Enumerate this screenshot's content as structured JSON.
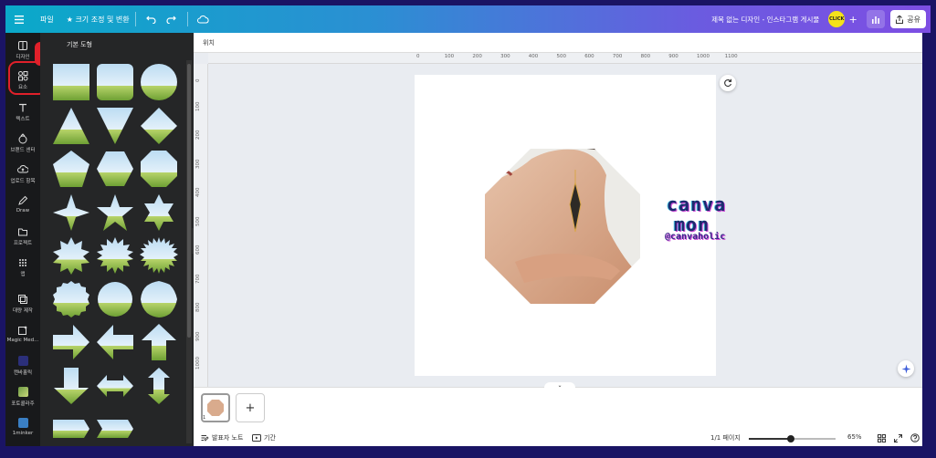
{
  "topbar": {
    "menu_icon": "menu-icon",
    "file_label": "파일",
    "resize_label": "★ 크기 조정 및 변환",
    "undo_icon": "undo-icon",
    "redo_icon": "redo-icon",
    "cloud_icon": "cloud-save-icon",
    "doc_title": "제목 없는 디자인 - 인스타그램 게시물",
    "click_badge": "CLICK",
    "plus_label": "+",
    "share_label": "공유"
  },
  "rail": {
    "items": [
      {
        "label": "디자인",
        "icon": "design-icon"
      },
      {
        "label": "요소",
        "icon": "elements-icon"
      },
      {
        "label": "텍스트",
        "icon": "text-icon"
      },
      {
        "label": "브랜드 센터",
        "icon": "brand-icon"
      },
      {
        "label": "업로드 항목",
        "icon": "upload-icon"
      },
      {
        "label": "Draw",
        "icon": "draw-icon"
      },
      {
        "label": "프로젝트",
        "icon": "projects-icon"
      },
      {
        "label": "앱",
        "icon": "apps-icon"
      },
      {
        "label": "대량 제작",
        "icon": "bulk-create-icon"
      },
      {
        "label": "Magic Med...",
        "icon": "magic-media-icon"
      },
      {
        "label": "캔바홀릭",
        "icon": "canvaholic-app-icon"
      },
      {
        "label": "포토콜라주",
        "icon": "photo-collage-icon"
      },
      {
        "label": "1minker",
        "icon": "1minker-app-icon"
      }
    ]
  },
  "panel": {
    "title": "기본 도형",
    "shapes": [
      "rectangle",
      "rounded-rectangle",
      "circle",
      "triangle",
      "inverted-triangle",
      "diamond",
      "pentagon",
      "hexagon",
      "octagon",
      "four-point-star",
      "five-point-star",
      "six-point-star",
      "eight-point-star",
      "twelve-point-star",
      "starburst",
      "seal-badge",
      "scalloped-circle",
      "wavy-circle",
      "right-arrow",
      "left-arrow",
      "up-arrow",
      "down-arrow",
      "double-arrow",
      "vertical-double-arrow",
      "right-chevron-banner",
      "double-chevron-banner"
    ]
  },
  "editor": {
    "position_label": "위치",
    "ruler_x": [
      "0",
      "100",
      "200",
      "300",
      "400",
      "500",
      "600",
      "700",
      "800",
      "900",
      "1000",
      "1100"
    ],
    "ruler_y": [
      "0",
      "100",
      "200",
      "300",
      "400",
      "500",
      "600",
      "700",
      "800",
      "900",
      "1000"
    ],
    "brand_line1": "canva",
    "brand_line2": "mon",
    "handle": "@canvaholic",
    "refresh_icon": "refresh-icon",
    "magic_icon": "magic-sparkle-icon"
  },
  "pages": {
    "thumb_number": "1",
    "add_label": "+",
    "collapse_icon": "chevron-down-icon"
  },
  "statusbar": {
    "notes_label": "발표자 노트",
    "duration_label": "기간",
    "page_count": "1/1 페이지",
    "zoom": "65%",
    "zoom_value": 0.48
  },
  "annotation": {
    "number": "1"
  },
  "colors": {
    "accent": "#e0202a",
    "topbar_start": "#0aa9c9",
    "topbar_end": "#7d4ee3"
  }
}
